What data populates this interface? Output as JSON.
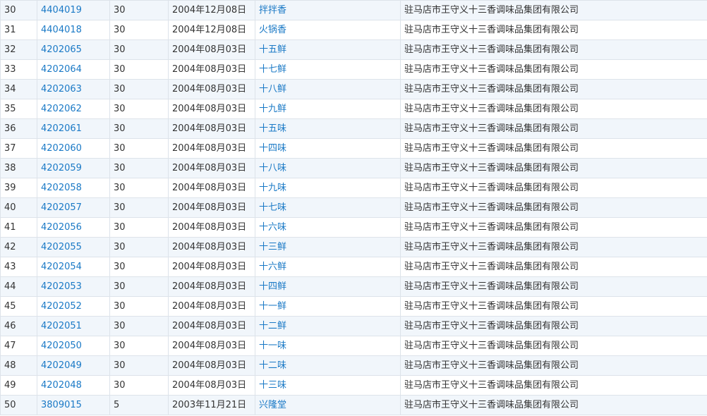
{
  "colors": {
    "link": "#1a79c6",
    "text": "#333333",
    "row_alt": "#f1f6fb",
    "border": "#dde3ea"
  },
  "rows": [
    {
      "idx": "30",
      "reg_no": "4404019",
      "cls": "30",
      "date": "2004年12月08日",
      "name": "拌拌香",
      "owner": "驻马店市王守义十三香调味品集团有限公司"
    },
    {
      "idx": "31",
      "reg_no": "4404018",
      "cls": "30",
      "date": "2004年12月08日",
      "name": "火锅香",
      "owner": "驻马店市王守义十三香调味品集团有限公司"
    },
    {
      "idx": "32",
      "reg_no": "4202065",
      "cls": "30",
      "date": "2004年08月03日",
      "name": "十五鲜",
      "owner": "驻马店市王守义十三香调味品集团有限公司"
    },
    {
      "idx": "33",
      "reg_no": "4202064",
      "cls": "30",
      "date": "2004年08月03日",
      "name": "十七鲜",
      "owner": "驻马店市王守义十三香调味品集团有限公司"
    },
    {
      "idx": "34",
      "reg_no": "4202063",
      "cls": "30",
      "date": "2004年08月03日",
      "name": "十八鲜",
      "owner": "驻马店市王守义十三香调味品集团有限公司"
    },
    {
      "idx": "35",
      "reg_no": "4202062",
      "cls": "30",
      "date": "2004年08月03日",
      "name": "十九鲜",
      "owner": "驻马店市王守义十三香调味品集团有限公司"
    },
    {
      "idx": "36",
      "reg_no": "4202061",
      "cls": "30",
      "date": "2004年08月03日",
      "name": "十五味",
      "owner": "驻马店市王守义十三香调味品集团有限公司"
    },
    {
      "idx": "37",
      "reg_no": "4202060",
      "cls": "30",
      "date": "2004年08月03日",
      "name": "十四味",
      "owner": "驻马店市王守义十三香调味品集团有限公司"
    },
    {
      "idx": "38",
      "reg_no": "4202059",
      "cls": "30",
      "date": "2004年08月03日",
      "name": "十八味",
      "owner": "驻马店市王守义十三香调味品集团有限公司"
    },
    {
      "idx": "39",
      "reg_no": "4202058",
      "cls": "30",
      "date": "2004年08月03日",
      "name": "十九味",
      "owner": "驻马店市王守义十三香调味品集团有限公司"
    },
    {
      "idx": "40",
      "reg_no": "4202057",
      "cls": "30",
      "date": "2004年08月03日",
      "name": "十七味",
      "owner": "驻马店市王守义十三香调味品集团有限公司"
    },
    {
      "idx": "41",
      "reg_no": "4202056",
      "cls": "30",
      "date": "2004年08月03日",
      "name": "十六味",
      "owner": "驻马店市王守义十三香调味品集团有限公司"
    },
    {
      "idx": "42",
      "reg_no": "4202055",
      "cls": "30",
      "date": "2004年08月03日",
      "name": "十三鲜",
      "owner": "驻马店市王守义十三香调味品集团有限公司"
    },
    {
      "idx": "43",
      "reg_no": "4202054",
      "cls": "30",
      "date": "2004年08月03日",
      "name": "十六鲜",
      "owner": "驻马店市王守义十三香调味品集团有限公司"
    },
    {
      "idx": "44",
      "reg_no": "4202053",
      "cls": "30",
      "date": "2004年08月03日",
      "name": "十四鲜",
      "owner": "驻马店市王守义十三香调味品集团有限公司"
    },
    {
      "idx": "45",
      "reg_no": "4202052",
      "cls": "30",
      "date": "2004年08月03日",
      "name": "十一鲜",
      "owner": "驻马店市王守义十三香调味品集团有限公司"
    },
    {
      "idx": "46",
      "reg_no": "4202051",
      "cls": "30",
      "date": "2004年08月03日",
      "name": "十二鲜",
      "owner": "驻马店市王守义十三香调味品集团有限公司"
    },
    {
      "idx": "47",
      "reg_no": "4202050",
      "cls": "30",
      "date": "2004年08月03日",
      "name": "十一味",
      "owner": "驻马店市王守义十三香调味品集团有限公司"
    },
    {
      "idx": "48",
      "reg_no": "4202049",
      "cls": "30",
      "date": "2004年08月03日",
      "name": "十二味",
      "owner": "驻马店市王守义十三香调味品集团有限公司"
    },
    {
      "idx": "49",
      "reg_no": "4202048",
      "cls": "30",
      "date": "2004年08月03日",
      "name": "十三味",
      "owner": "驻马店市王守义十三香调味品集团有限公司"
    },
    {
      "idx": "50",
      "reg_no": "3809015",
      "cls": "5",
      "date": "2003年11月21日",
      "name": "兴隆堂",
      "owner": "驻马店市王守义十三香调味品集团有限公司"
    }
  ]
}
